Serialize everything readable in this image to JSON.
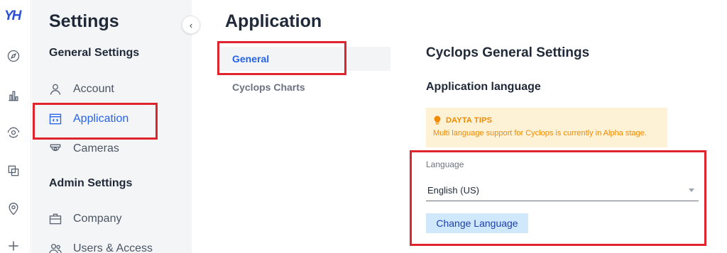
{
  "rail": {
    "logo": "YH",
    "icons": [
      "compass-icon",
      "bar-chart-icon",
      "camera-scan-icon",
      "layers-icon",
      "map-pin-icon",
      "plus-icon"
    ]
  },
  "settings": {
    "title": "Settings",
    "general_section": "General Settings",
    "general_items": [
      {
        "label": "Account",
        "icon": "user-icon"
      },
      {
        "label": "Application",
        "icon": "code-window-icon",
        "active": true
      },
      {
        "label": "Cameras",
        "icon": "camera-icon"
      }
    ],
    "admin_section": "Admin Settings",
    "admin_items": [
      {
        "label": "Company",
        "icon": "briefcase-icon"
      },
      {
        "label": "Users & Access",
        "icon": "users-icon"
      }
    ]
  },
  "main": {
    "title": "Application",
    "tabs": [
      {
        "label": "General",
        "active": true
      },
      {
        "label": "Cyclops Charts",
        "active": false
      }
    ],
    "content_title": "Cyclops General Settings",
    "content_subtitle": "Application language",
    "tips": {
      "heading": "DAYTA TIPS",
      "text": "Multi language support for Cyclops is currently in Alpha stage."
    },
    "language": {
      "label": "Language",
      "selected": "English (US)"
    },
    "change_button": "Change Language"
  },
  "colors": {
    "accent": "#2563eb",
    "tips_bg": "#fdf1d6",
    "tips_text": "#f08a00",
    "highlight": "#e0242d",
    "button_bg": "#cfe8fb"
  }
}
